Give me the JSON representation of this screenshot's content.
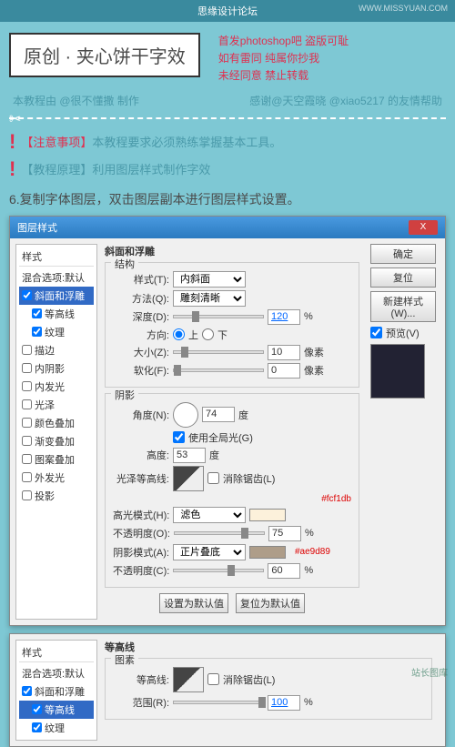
{
  "header": {
    "forum": "思缘设计论坛",
    "url": "WWW.MISSYUAN.COM"
  },
  "title": {
    "main": "原创 · 夹心饼干字效",
    "warn1": "首发photoshop吧  盗版可耻",
    "warn2": "如有雷同 纯属你抄我",
    "warn3": "未经同意 禁止转载"
  },
  "credit": {
    "left": "本教程由 @很不懂撒 制作",
    "right": "感谢@天空霞晓 @xiao5217 的友情帮助"
  },
  "notes": {
    "line1_label": "【注意事项】",
    "line1_text": "本教程要求必须熟练掌握基本工具。",
    "line2_label": "【教程原理】",
    "line2_text": "利用图层样式制作字效"
  },
  "step": "6.复制字体图层，双击图层副本进行图层样式设置。",
  "dialog1": {
    "title": "图层样式",
    "styles_header": "样式",
    "blend_default": "混合选项:默认",
    "bevel": "斜面和浮雕",
    "contour_sub": "等高线",
    "texture_sub": "纹理",
    "stroke": "描边",
    "inner_shadow": "内阴影",
    "inner_glow": "内发光",
    "satin": "光泽",
    "color_overlay": "颜色叠加",
    "gradient_overlay": "渐变叠加",
    "pattern_overlay": "图案叠加",
    "outer_glow": "外发光",
    "drop_shadow": "投影",
    "panel_title": "斜面和浮雕",
    "structure": "结构",
    "style_label": "样式(T):",
    "style_val": "内斜面",
    "method_label": "方法(Q):",
    "method_val": "雕刻清晰",
    "depth_label": "深度(D):",
    "depth_val": "120",
    "pct": "%",
    "dir_label": "方向:",
    "dir_up": "上",
    "dir_down": "下",
    "size_label": "大小(Z):",
    "size_val": "10",
    "px": "像素",
    "soften_label": "软化(F):",
    "soften_val": "0",
    "shading": "阴影",
    "angle_label": "角度(N):",
    "angle_val": "74",
    "deg": "度",
    "global": "使用全局光(G)",
    "altitude_label": "高度:",
    "altitude_val": "53",
    "gloss_label": "光泽等高线:",
    "antialias": "消除锯齿(L)",
    "hex1": "#fcf1db",
    "highlight_label": "高光模式(H):",
    "highlight_val": "滤色",
    "opacity1_label": "不透明度(O):",
    "opacity1_val": "75",
    "shadow_label": "阴影模式(A):",
    "shadow_val": "正片叠底",
    "hex2": "#ae9d89",
    "opacity2_label": "不透明度(C):",
    "opacity2_val": "60",
    "btn_default1": "设置为默认值",
    "btn_default2": "复位为默认值",
    "ok": "确定",
    "cancel": "复位",
    "new_style": "新建样式(W)...",
    "preview": "预览(V)"
  },
  "dialog2": {
    "panel_title": "等高线",
    "elements": "图素",
    "contour_label": "等高线:",
    "antialias": "消除锯齿(L)",
    "range_label": "范围(R):",
    "range_val": "100",
    "pct": "%"
  },
  "footer": "站长图库"
}
